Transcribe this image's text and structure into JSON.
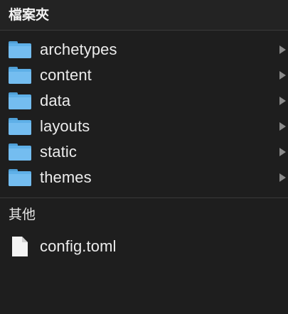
{
  "sections": {
    "folders_title": "檔案夾",
    "other_title": "其他"
  },
  "folders": [
    {
      "label": "archetypes",
      "icon": "folder-icon"
    },
    {
      "label": "content",
      "icon": "folder-icon"
    },
    {
      "label": "data",
      "icon": "folder-icon"
    },
    {
      "label": "layouts",
      "icon": "folder-icon"
    },
    {
      "label": "static",
      "icon": "folder-icon"
    },
    {
      "label": "themes",
      "icon": "folder-icon"
    }
  ],
  "files": [
    {
      "label": "config.toml",
      "icon": "document-icon"
    }
  ],
  "colors": {
    "background": "#1e1e1e",
    "folder_blue": "#74bdf0",
    "chevron": "#8a8a8a",
    "text": "#ececec"
  }
}
